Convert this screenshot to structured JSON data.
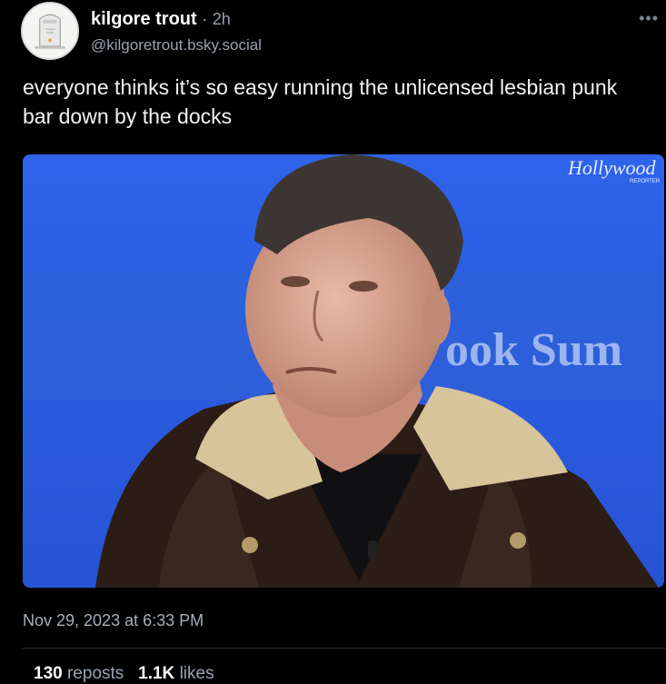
{
  "post": {
    "display_name": "kilgore trout",
    "time_separator": "·",
    "time_ago": "2h",
    "handle": "@kilgoretrout.bsky.social",
    "text": "everyone thinks it’s so easy running the unlicensed lesbian punk bar down by the docks",
    "timestamp": "Nov 29, 2023 at 6:33 PM",
    "reposts_count": "130",
    "reposts_label": "reposts",
    "likes_count": "1.1K",
    "likes_label": "likes"
  },
  "media": {
    "watermark": "Hollywood",
    "watermark_sub": "REPORTER",
    "background_sign_text": "ook Sum"
  },
  "icons": {
    "more": "more-horizontal-icon",
    "avatar": "gravestone-avatar"
  },
  "colors": {
    "background": "#000000",
    "text": "#f1f3f5",
    "muted": "#9aa3ad",
    "stage_blue": "#2d5fe6"
  }
}
